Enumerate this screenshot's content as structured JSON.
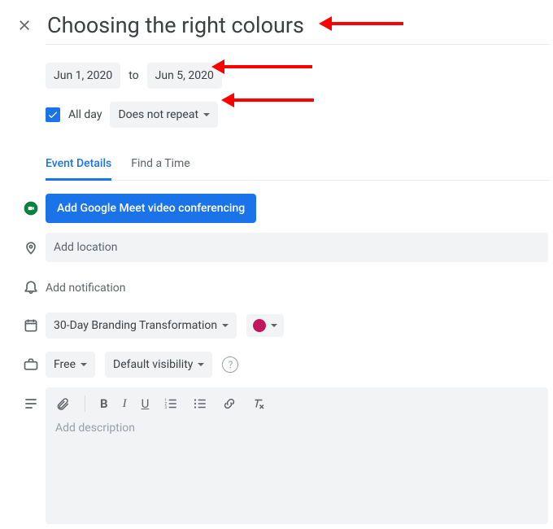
{
  "title": "Choosing the right colours",
  "dates": {
    "start": "Jun 1, 2020",
    "to_label": "to",
    "end": "Jun 5, 2020"
  },
  "allday": {
    "checked": true,
    "label": "All day"
  },
  "repeat": {
    "label": "Does not repeat"
  },
  "tabs": {
    "event_details": "Event Details",
    "find_a_time": "Find a Time"
  },
  "meet": {
    "button_label": "Add Google Meet video conferencing"
  },
  "location": {
    "placeholder": "Add location"
  },
  "notification": {
    "add_label": "Add notification"
  },
  "calendar_select": {
    "label": "30-Day Branding Transformation"
  },
  "color": {
    "hex": "#c2185b"
  },
  "availability": {
    "label": "Free"
  },
  "visibility": {
    "label": "Default visibility"
  },
  "description": {
    "placeholder": "Add description"
  },
  "toolbar": {
    "bold": "B",
    "italic": "I",
    "underline": "U"
  }
}
